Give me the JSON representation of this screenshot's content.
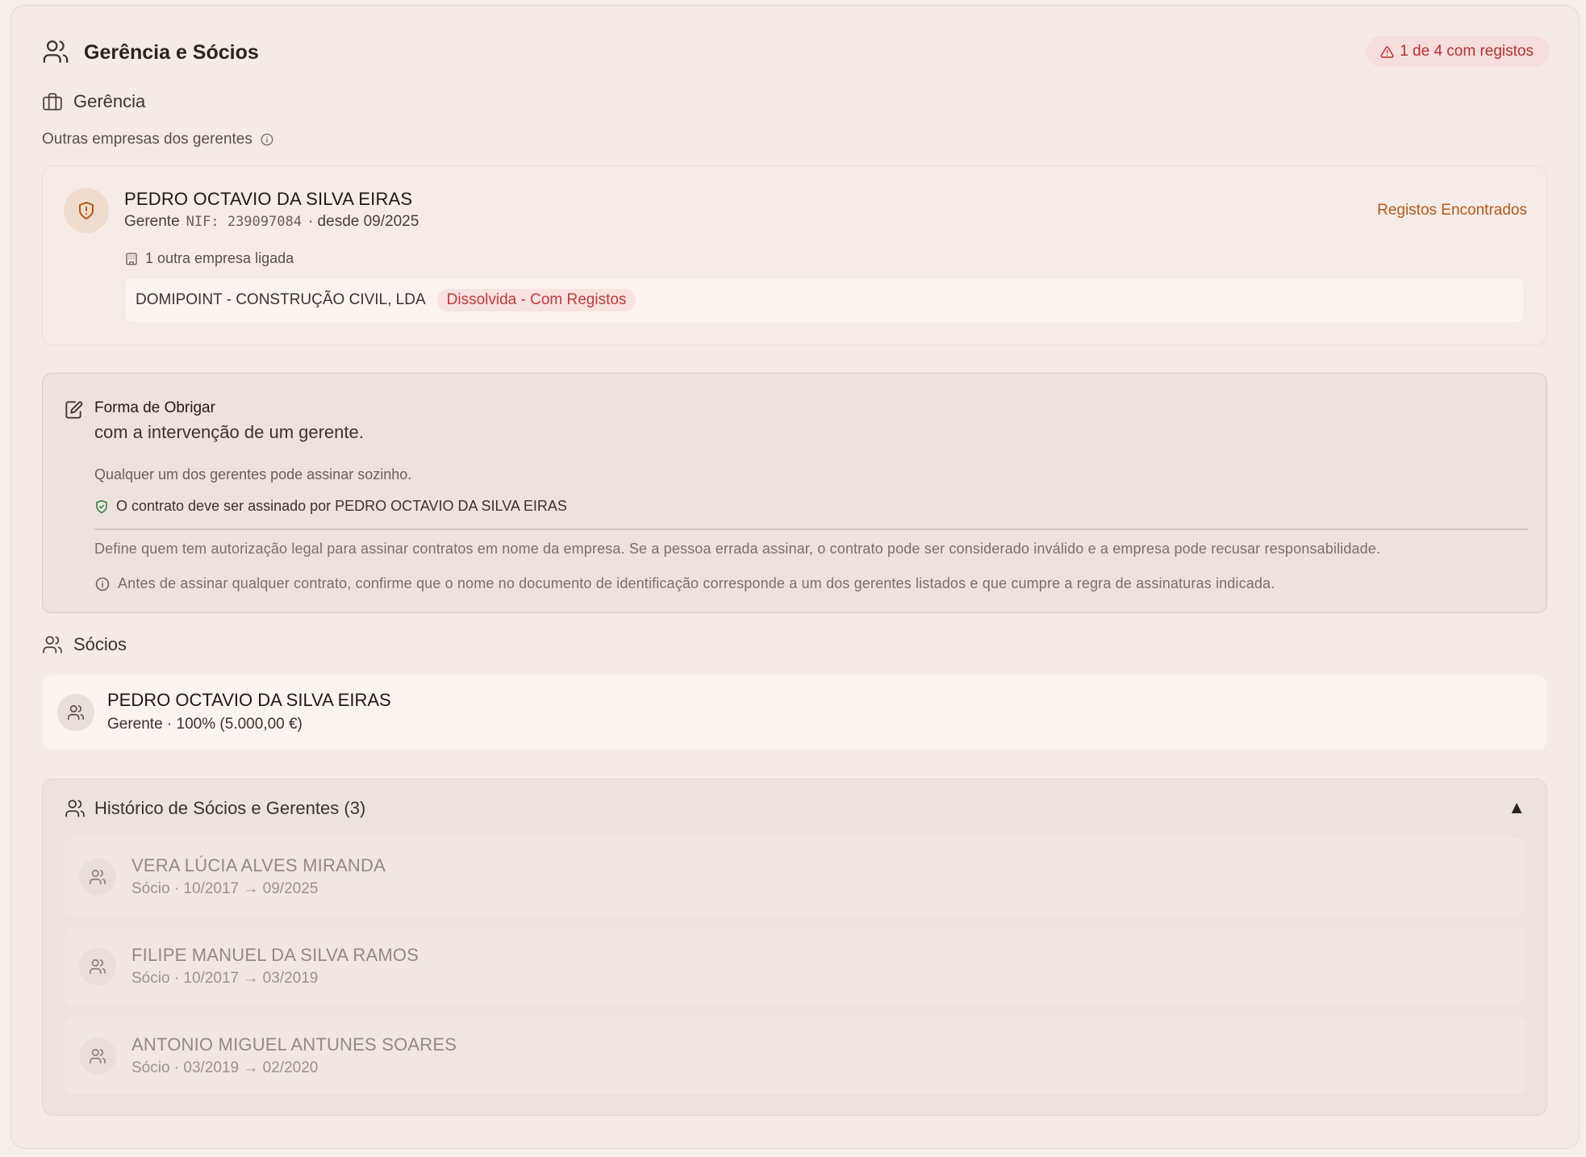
{
  "header": {
    "title": "Gerência e Sócios",
    "badge": "1 de 4 com registos"
  },
  "gerencia": {
    "title": "Gerência",
    "subtitle": "Outras empresas dos gerentes",
    "manager": {
      "name": "PEDRO OCTAVIO DA SILVA EIRAS",
      "role": "Gerente",
      "nif": "NIF: 239097084",
      "since": "· desde 09/2025",
      "flag": "Registos Encontrados",
      "linked_count": "1 outra empresa ligada",
      "company": {
        "name": "DOMIPOINT - CONSTRUÇÃO CIVIL, LDA",
        "status": "Dissolvida - Com Registos"
      }
    }
  },
  "forma_obrigar": {
    "label": "Forma de Obrigar",
    "rule": "com a intervenção de um gerente.",
    "explanation": "Qualquer um dos gerentes pode assinar sozinho.",
    "signer": "O contrato deve ser assinado por PEDRO OCTAVIO DA SILVA EIRAS",
    "definition": "Define quem tem autorização legal para assinar contratos em nome da empresa. Se a pessoa errada assinar, o contrato pode ser considerado inválido e a empresa pode recusar responsabilidade.",
    "tip": "Antes de assinar qualquer contrato, confirme que o nome no documento de identificação corresponde a um dos gerentes listados e que cumpre a regra de assinaturas indicada."
  },
  "socios": {
    "title": "Sócios",
    "items": [
      {
        "name": "PEDRO OCTAVIO DA SILVA EIRAS",
        "details": "Gerente · 100% (5.000,00 €)"
      }
    ]
  },
  "historico": {
    "title": "Histórico de Sócios e Gerentes (3)",
    "toggle": "▲",
    "items": [
      {
        "name": "VERA LÚCIA ALVES MIRANDA",
        "role": "Sócio",
        "period": "· 10/2017 → 09/2025"
      },
      {
        "name": "FILIPE MANUEL DA SILVA RAMOS",
        "role": "Sócio",
        "period": "· 10/2017 → 03/2019"
      },
      {
        "name": "ANTONIO MIGUEL ANTUNES SOARES",
        "role": "Sócio",
        "period": "· 03/2019 → 02/2020"
      }
    ]
  },
  "colors": {
    "warning": "#b1322f",
    "flag": "#b1581a",
    "ok": "#2e7d43"
  }
}
